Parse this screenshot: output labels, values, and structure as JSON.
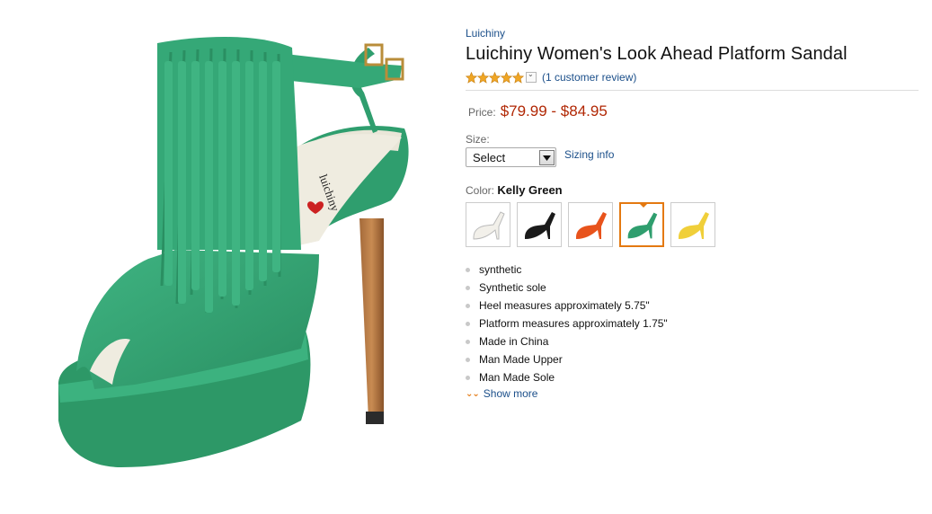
{
  "product": {
    "brand": "Luichiny",
    "title": "Luichiny Women's Look Ahead Platform Sandal",
    "rating_stars": 5,
    "review_link": "(1 customer review)",
    "price_label": "Price:",
    "price": "$79.99 - $84.95",
    "size_label": "Size:",
    "size_selected": "Select",
    "sizing_info_link": "Sizing info",
    "color_label": "Color:",
    "color_value": "Kelly Green",
    "swatches": [
      {
        "color": "white",
        "hex": "#f2f0ea"
      },
      {
        "color": "black",
        "hex": "#1a1a1a"
      },
      {
        "color": "orange",
        "hex": "#e8531c"
      },
      {
        "color": "kelly green",
        "hex": "#2f9e6e",
        "selected": true
      },
      {
        "color": "yellow",
        "hex": "#f0cf3a"
      }
    ],
    "features": [
      "synthetic",
      "Synthetic sole",
      "Heel measures approximately 5.75\"",
      "Platform measures approximately 1.75\"",
      "Made in China",
      "Man Made Upper",
      "Man Made Sole"
    ],
    "show_more": "Show more",
    "image_insole_brand": "luichiny"
  },
  "colors": {
    "link": "#1b4f8a",
    "price": "#b12704",
    "accent": "#e47911",
    "shoe_green": "#33a474",
    "star": "#f0a625"
  }
}
